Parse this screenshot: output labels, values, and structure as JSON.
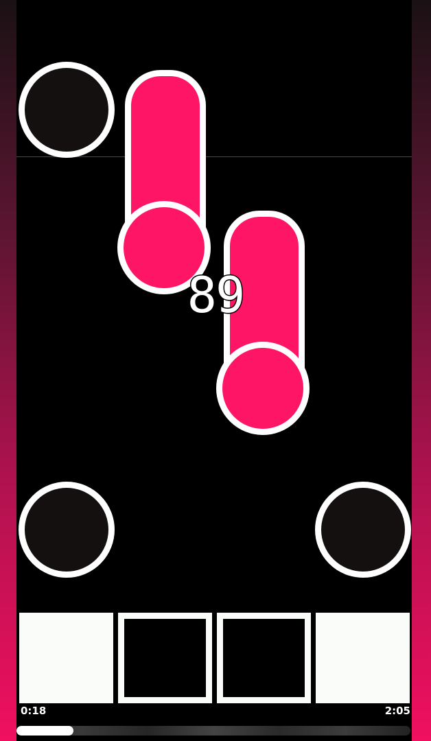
{
  "score": {
    "combo": "89"
  },
  "playback": {
    "elapsed": "0:18",
    "total": "2:05",
    "progress": 0.144
  },
  "colors": {
    "note": "#ff1565",
    "receptor": "#141010",
    "outline": "#ffffff",
    "accent_gradient_bottom": "#f0105f"
  },
  "lanes": [
    {
      "name": "lane-1",
      "key_state": "pressed"
    },
    {
      "name": "lane-2",
      "key_state": "released"
    },
    {
      "name": "lane-3",
      "key_state": "released"
    },
    {
      "name": "lane-4",
      "key_state": "pressed"
    }
  ]
}
